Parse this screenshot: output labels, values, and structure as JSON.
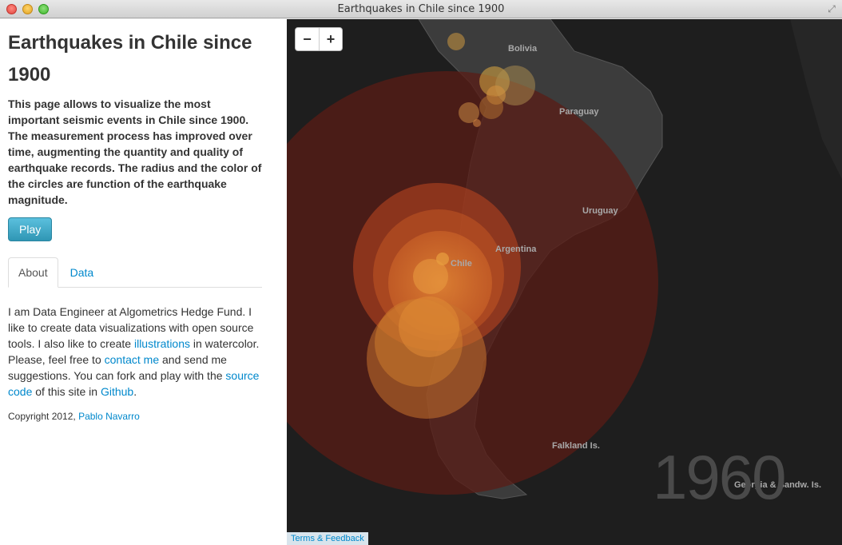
{
  "window": {
    "title": "Earthquakes in Chile since 1900"
  },
  "sidebar": {
    "heading": "Earthquakes in Chile since 1900",
    "intro": "This page allows to visualize the most important seismic events in Chile since 1900. The measurement process has improved over time, augmenting the quantity and quality of earthquake records. The radius and the color of the circles are function of the earthquake magnitude.",
    "play_label": "Play",
    "tabs": [
      {
        "label": "About",
        "active": true
      },
      {
        "label": "Data",
        "active": false
      }
    ],
    "about": {
      "t1": "I am Data Engineer at Algometrics Hedge Fund. I like to create data visualizations with open source tools. I also like to create ",
      "link1": "illustrations",
      "t2": " in watercolor. Please, feel free to ",
      "link2": "contact me",
      "t3": " and send me suggestions. You can fork and play with the ",
      "link3": "source code",
      "t4": " of this site in ",
      "link4": "Github",
      "t5": "."
    },
    "copyright_text": "Copyright 2012, ",
    "copyright_link": "Pablo Navarro"
  },
  "map": {
    "zoom_out": "−",
    "zoom_in": "+",
    "labels": {
      "bolivia": "Bolivia",
      "paraguay": "Paraguay",
      "uruguay": "Uruguay",
      "argentina": "Argentina",
      "chile": "Chile",
      "falkland": "Falkland Is.",
      "south_georgia": "Georgia & Sandw. Is."
    },
    "year": "1960",
    "terms": "Terms & Feedback"
  },
  "colors": {
    "map_bg": "#1e1e1e",
    "land": "#3a3a3a",
    "big_circle": "#5a1c16",
    "quake_orange": "#e07a2a",
    "link": "#0088cc",
    "play_button": "#49afcd"
  }
}
